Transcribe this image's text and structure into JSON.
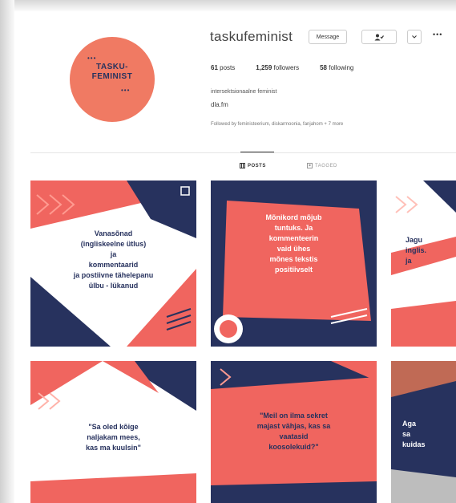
{
  "profile": {
    "avatar_text_line1": "TASKU-",
    "avatar_text_line2": "FEMINIST",
    "username": "taskufeminist",
    "message_button": "Message",
    "more_button": "•••",
    "stats": {
      "posts_count": "61",
      "posts_label": "posts",
      "followers_count": "1,259",
      "followers_label": "followers",
      "following_count": "58",
      "following_label": "following"
    },
    "bio_line1": "intersektsionaalne feminist",
    "bio_line2": "dla.fm",
    "followed_by": "Followed by feministeerium, diskarmoonia, fanjahom + 7 more"
  },
  "tabs": [
    {
      "label": "POSTS"
    },
    {
      "label": "TAGGED"
    }
  ],
  "posts": [
    {
      "lines": [
        "Vanasõnad",
        "(ingliskeelne ütlus)",
        "ja",
        "kommentaarid",
        "ja postiivne tähelepanu",
        "ülbu - lükanud"
      ],
      "bg": "#ffffff",
      "text_color": "#27325e"
    },
    {
      "lines": [
        "Mõnikord mõjub",
        "tuntuks. Ja",
        "kommenteerin",
        "vaid ühes",
        "mõnes tekstis",
        "positiivselt"
      ],
      "bg": "#f0655f",
      "text_color": "#ffffff"
    },
    {
      "lines": [
        "Jagu",
        "inglis.",
        "ja"
      ],
      "bg": "#ffffff",
      "text_color": "#27325e"
    },
    {
      "lines": [
        "\"Sa oled kõige",
        "naljakam mees,",
        "kas ma kuulsin\""
      ],
      "bg": "#ffffff",
      "text_color": "#27325e"
    },
    {
      "lines": [
        "\"Meil on ilma sekret",
        "majast vähjas, kas sa",
        "vaatasid",
        "koosolekuid?\""
      ],
      "bg": "#f0655f",
      "text_color": "#27325e"
    },
    {
      "lines": [
        "Aga",
        "sa",
        "kuidas"
      ],
      "bg": "#27325e",
      "text_color": "#ffffff"
    }
  ],
  "colors": {
    "coral": "#f0655f",
    "navy": "#27325e",
    "salmon": "#f07a63"
  }
}
